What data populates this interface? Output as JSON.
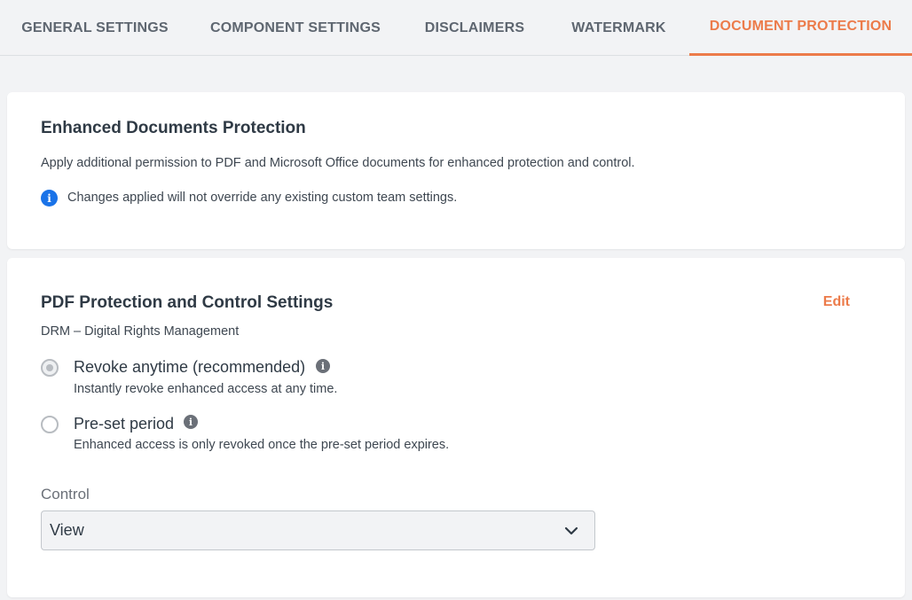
{
  "tabs": [
    {
      "label": "GENERAL SETTINGS"
    },
    {
      "label": "COMPONENT SETTINGS"
    },
    {
      "label": "DISCLAIMERS"
    },
    {
      "label": "WATERMARK"
    },
    {
      "label": "DOCUMENT PROTECTION",
      "active": true
    }
  ],
  "enhanced": {
    "title": "Enhanced Documents Protection",
    "description": "Apply additional permission to PDF and Microsoft Office documents for enhanced protection and control.",
    "notice": "Changes applied will not override any existing custom team settings."
  },
  "pdf": {
    "title": "PDF Protection and Control Settings",
    "edit_label": "Edit",
    "subtitle": "DRM – Digital Rights Management",
    "options": [
      {
        "label": "Revoke anytime (recommended)",
        "description": "Instantly revoke enhanced access at any time.",
        "selected": true
      },
      {
        "label": "Pre-set period",
        "description": "Enhanced access is only revoked once the pre-set period expires.",
        "selected": false
      }
    ],
    "control_label": "Control",
    "control_value": "View"
  },
  "icons": {
    "info_blue": "info-icon",
    "info_grey": "info-icon",
    "chevron": "chevron-down-icon"
  },
  "colors": {
    "accent": "#ec7b4a",
    "info_blue": "#1a73e8",
    "background": "#f2f3f5"
  }
}
